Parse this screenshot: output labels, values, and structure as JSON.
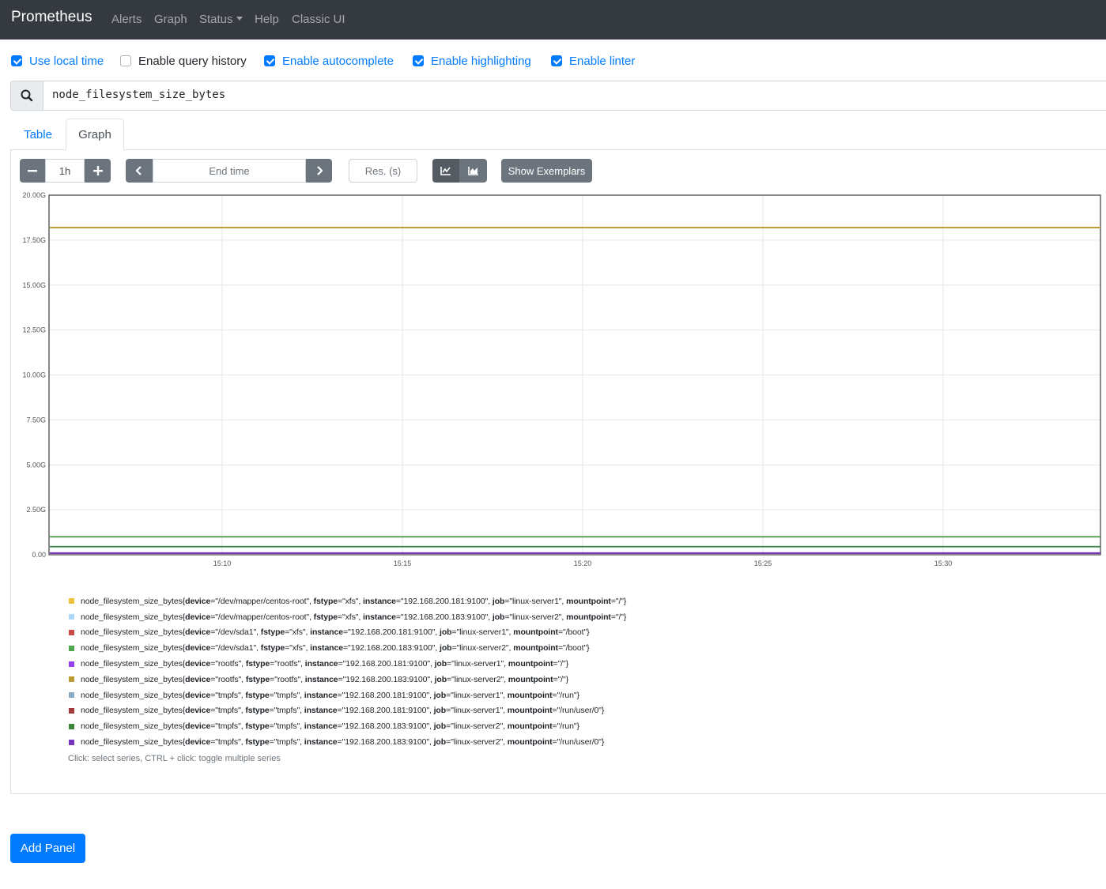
{
  "navbar": {
    "brand": "Prometheus",
    "items": [
      "Alerts",
      "Graph",
      "Status",
      "Help",
      "Classic UI"
    ]
  },
  "options": [
    {
      "label": "Use local time",
      "checked": true
    },
    {
      "label": "Enable query history",
      "checked": false
    },
    {
      "label": "Enable autocomplete",
      "checked": true
    },
    {
      "label": "Enable highlighting",
      "checked": true
    },
    {
      "label": "Enable linter",
      "checked": true
    }
  ],
  "query": {
    "icon": "search-icon",
    "value": "node_filesystem_size_bytes"
  },
  "tabs": {
    "table": "Table",
    "graph": "Graph"
  },
  "controls": {
    "range_minus": "−",
    "range": "1h",
    "range_plus": "+",
    "end_time_placeholder": "End time",
    "res_placeholder": "Res. (s)",
    "show_exemplars": "Show Exemplars"
  },
  "chart_data": {
    "type": "line",
    "y_ticks": [
      "20.00G",
      "17.50G",
      "15.00G",
      "12.50G",
      "10.00G",
      "7.50G",
      "5.00G",
      "2.50G",
      "0.00"
    ],
    "x_ticks": [
      "15:10",
      "15:15",
      "15:20",
      "15:25",
      "15:30"
    ],
    "ylim": [
      0,
      20
    ],
    "y_unit": "G",
    "grid": true,
    "series": [
      {
        "color": "#edc240",
        "value_g": 18.2
      },
      {
        "color": "#afd8f8",
        "value_g": 18.2
      },
      {
        "color": "#cb4b4b",
        "value_g": 1.0
      },
      {
        "color": "#4da74d",
        "value_g": 1.0
      },
      {
        "color": "#9440ed",
        "value_g": 0.1
      },
      {
        "color": "#bd9b33",
        "value_g": 18.2
      },
      {
        "color": "#8cacc6",
        "value_g": 0.45
      },
      {
        "color": "#a23c3c",
        "value_g": 0.09
      },
      {
        "color": "#3d853d",
        "value_g": 0.45
      },
      {
        "color": "#7633bd",
        "value_g": 0.09
      }
    ]
  },
  "legend": [
    {
      "color": "#edc240",
      "metric": "node_filesystem_size_bytes",
      "labels": [
        [
          "device",
          "/dev/mapper/centos-root"
        ],
        [
          "fstype",
          "xfs"
        ],
        [
          "instance",
          "192.168.200.181:9100"
        ],
        [
          "job",
          "linux-server1"
        ],
        [
          "mountpoint",
          "/"
        ]
      ]
    },
    {
      "color": "#afd8f8",
      "metric": "node_filesystem_size_bytes",
      "labels": [
        [
          "device",
          "/dev/mapper/centos-root"
        ],
        [
          "fstype",
          "xfs"
        ],
        [
          "instance",
          "192.168.200.183:9100"
        ],
        [
          "job",
          "linux-server2"
        ],
        [
          "mountpoint",
          "/"
        ]
      ]
    },
    {
      "color": "#cb4b4b",
      "metric": "node_filesystem_size_bytes",
      "labels": [
        [
          "device",
          "/dev/sda1"
        ],
        [
          "fstype",
          "xfs"
        ],
        [
          "instance",
          "192.168.200.181:9100"
        ],
        [
          "job",
          "linux-server1"
        ],
        [
          "mountpoint",
          "/boot"
        ]
      ]
    },
    {
      "color": "#4da74d",
      "metric": "node_filesystem_size_bytes",
      "labels": [
        [
          "device",
          "/dev/sda1"
        ],
        [
          "fstype",
          "xfs"
        ],
        [
          "instance",
          "192.168.200.183:9100"
        ],
        [
          "job",
          "linux-server2"
        ],
        [
          "mountpoint",
          "/boot"
        ]
      ]
    },
    {
      "color": "#9440ed",
      "metric": "node_filesystem_size_bytes",
      "labels": [
        [
          "device",
          "rootfs"
        ],
        [
          "fstype",
          "rootfs"
        ],
        [
          "instance",
          "192.168.200.181:9100"
        ],
        [
          "job",
          "linux-server1"
        ],
        [
          "mountpoint",
          "/"
        ]
      ]
    },
    {
      "color": "#bd9b33",
      "metric": "node_filesystem_size_bytes",
      "labels": [
        [
          "device",
          "rootfs"
        ],
        [
          "fstype",
          "rootfs"
        ],
        [
          "instance",
          "192.168.200.183:9100"
        ],
        [
          "job",
          "linux-server2"
        ],
        [
          "mountpoint",
          "/"
        ]
      ]
    },
    {
      "color": "#8cacc6",
      "metric": "node_filesystem_size_bytes",
      "labels": [
        [
          "device",
          "tmpfs"
        ],
        [
          "fstype",
          "tmpfs"
        ],
        [
          "instance",
          "192.168.200.181:9100"
        ],
        [
          "job",
          "linux-server1"
        ],
        [
          "mountpoint",
          "/run"
        ]
      ]
    },
    {
      "color": "#a23c3c",
      "metric": "node_filesystem_size_bytes",
      "labels": [
        [
          "device",
          "tmpfs"
        ],
        [
          "fstype",
          "tmpfs"
        ],
        [
          "instance",
          "192.168.200.181:9100"
        ],
        [
          "job",
          "linux-server1"
        ],
        [
          "mountpoint",
          "/run/user/0"
        ]
      ]
    },
    {
      "color": "#3d853d",
      "metric": "node_filesystem_size_bytes",
      "labels": [
        [
          "device",
          "tmpfs"
        ],
        [
          "fstype",
          "tmpfs"
        ],
        [
          "instance",
          "192.168.200.183:9100"
        ],
        [
          "job",
          "linux-server2"
        ],
        [
          "mountpoint",
          "/run"
        ]
      ]
    },
    {
      "color": "#7633bd",
      "metric": "node_filesystem_size_bytes",
      "labels": [
        [
          "device",
          "tmpfs"
        ],
        [
          "fstype",
          "tmpfs"
        ],
        [
          "instance",
          "192.168.200.183:9100"
        ],
        [
          "job",
          "linux-server2"
        ],
        [
          "mountpoint",
          "/run/user/0"
        ]
      ]
    }
  ],
  "legend_hint": "Click: select series, CTRL + click: toggle multiple series",
  "add_panel": "Add Panel"
}
